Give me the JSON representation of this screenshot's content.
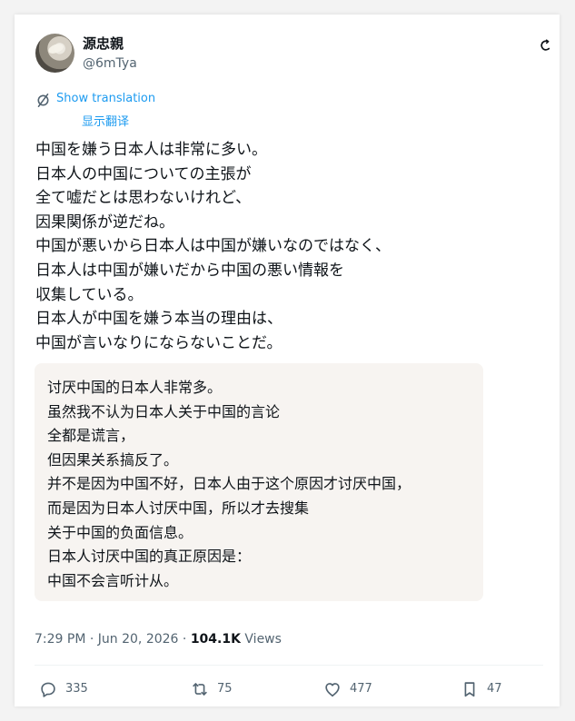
{
  "tweet": {
    "author": {
      "display_name": "源忠親",
      "handle": "@6mTya"
    },
    "translation_controls": {
      "show_translation_label": "Show translation",
      "translated_by_label": "显示翻译"
    },
    "text": "中国を嫌う日本人は非常に多い。\n日本人の中国についての主張が\n全て嘘だとは思わないけれど、\n因果関係が逆だね。\n中国が悪いから日本人は中国が嫌いなのではなく、\n日本人は中国が嫌いだから中国の悪い情報を\n収集している。\n日本人が中国を嫌う本当の理由は、\n中国が言いなりにならないことだ。",
    "translation_text": "讨厌中国的日本人非常多。\n虽然我不认为日本人关于中国的言论\n全都是谎言，\n但因果关系搞反了。\n并不是因为中国不好，日本人由于这个原因才讨厌中国，\n而是因为日本人讨厌中国，所以才去搜集\n关于中国的负面信息。\n日本人讨厌中国的真正原因是：\n中国不会言听计从。",
    "meta": {
      "time": "7:29 PM",
      "date": "Jun 20, 2026",
      "separator": "·",
      "views_count": "104.1K",
      "views_label": "Views"
    },
    "actions": {
      "replies": "335",
      "retweets": "75",
      "likes": "477",
      "bookmarks": "47"
    },
    "icons": {
      "header_right": "partial-icon",
      "translation": "translate-icon",
      "reply": "reply-icon",
      "retweet": "retweet-icon",
      "like": "heart-icon",
      "bookmark": "bookmark-icon"
    },
    "colors": {
      "text": "#0f1419",
      "secondary_text": "#536471",
      "link": "#1d9bf0",
      "translation_background": "#f7f4f1",
      "border": "#eff3f4"
    }
  }
}
